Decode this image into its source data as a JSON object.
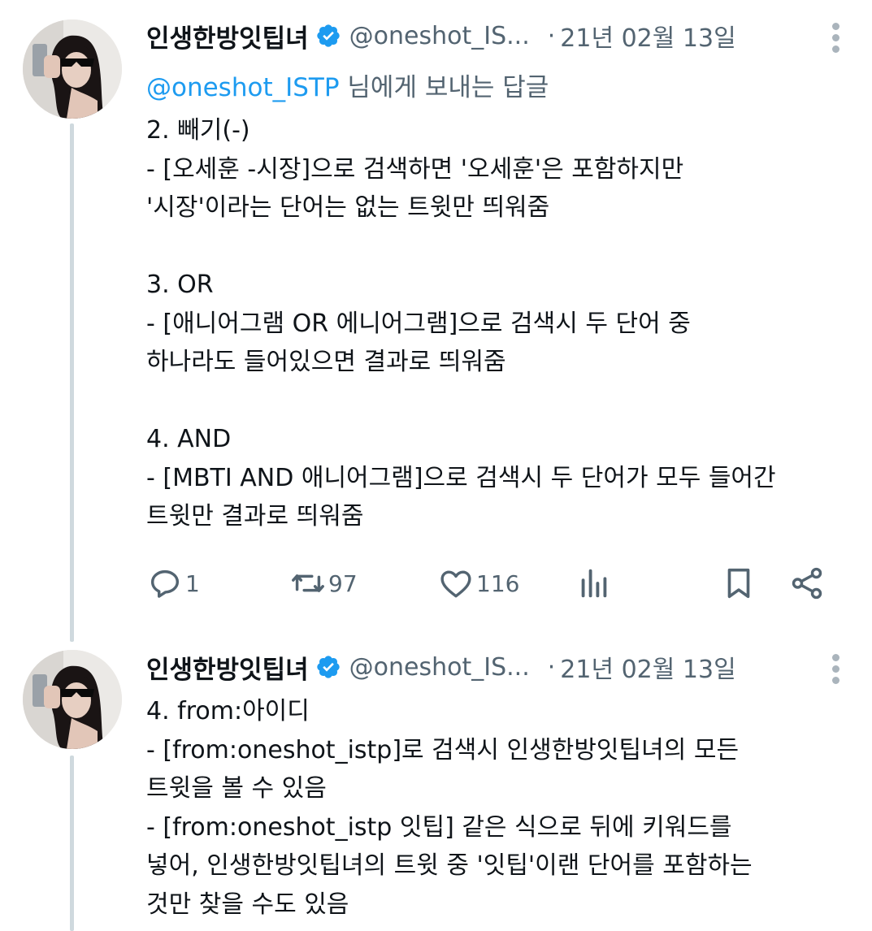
{
  "colors": {
    "accent": "#1d9bf0",
    "text_primary": "#0f1419",
    "text_secondary": "#536471",
    "thread_line": "#cfd9de"
  },
  "tweets": [
    {
      "display_name": "인생한방잇팁녀",
      "handle": "@oneshot_IS...",
      "separator": "·",
      "date": "21년 02월 13일",
      "reply_prefix": "@oneshot_ISTP",
      "reply_suffix": " 님에게 보내는 답글",
      "body": "2. 빼기(-)\n- [오세훈 -시장]으로 검색하면 '오세훈'은 포함하지만\n'시장'이라는 단어는 없는 트윗만 띄워줌\n\n3. OR\n- [애니어그램 OR 에니어그램]으로 검색시 두 단어 중\n하나라도 들어있으면 결과로 띄워줌\n\n4. AND\n- [MBTI AND 애니어그램]으로 검색시 두 단어가 모두 들어간\n트윗만 결과로 띄워줌",
      "actions": {
        "reply_icon": "reply-icon",
        "reply_count": "1",
        "retweet_icon": "retweet-icon",
        "retweet_count": "97",
        "like_icon": "heart-icon",
        "like_count": "116",
        "views_icon": "views-icon",
        "bookmark_icon": "bookmark-icon",
        "share_icon": "share-icon"
      }
    },
    {
      "display_name": "인생한방잇팁녀",
      "handle": "@oneshot_IS...",
      "separator": "·",
      "date": "21년 02월 13일",
      "body": "4. from:아이디\n- [from:oneshot_istp]로 검색시 인생한방잇팁녀의 모든\n트윗을 볼 수 있음\n- [from:oneshot_istp 잇팁] 같은 식으로 뒤에 키워드를\n넣어, 인생한방잇팁녀의 트윗 중 '잇팁'이랜 단어를 포함하는\n것만 찾을 수도 있음"
    }
  ]
}
